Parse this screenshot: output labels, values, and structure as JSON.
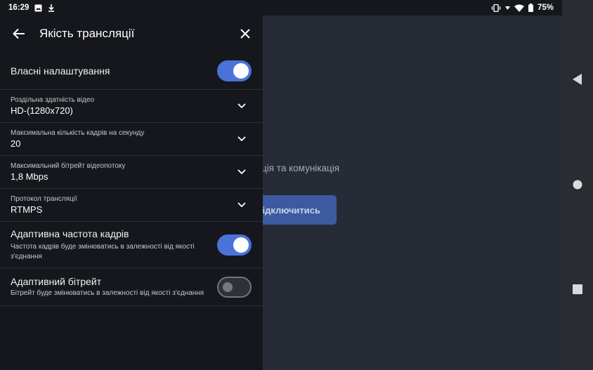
{
  "status_bar": {
    "time": "16:29",
    "battery": "75%",
    "icons": [
      "image-icon",
      "download-icon",
      "vibrate-icon",
      "signal-icon",
      "wifi-icon",
      "battery-icon"
    ]
  },
  "panel": {
    "title": "Якість трансляції",
    "own_settings": {
      "label": "Власні налаштування",
      "enabled": true
    },
    "resolution": {
      "label": "Роздільна здатність відео",
      "value": "HD-(1280x720)"
    },
    "fps": {
      "label": "Максимальна кількість кадрів на секунду",
      "value": "20"
    },
    "bitrate": {
      "label": "Максимальний бітрейт відеопотоку",
      "value": "1,8 Mbps"
    },
    "protocol": {
      "label": "Протокол трансляції",
      "value": "RTMPS"
    },
    "adaptive_fps": {
      "label": "Адаптивна частота кадрів",
      "description": "Частота кадрів буде змінюватись в залежності від якості з'єднання",
      "enabled": true
    },
    "adaptive_bitrate": {
      "label": "Адаптивний бітрейт",
      "description": "Бітрейт буде змінюватись в залежності від якості з'єднання",
      "enabled": false
    }
  },
  "background": {
    "text": "ція та комунікація",
    "button": "Підключитись"
  },
  "colors": {
    "accent": "#4a72d9",
    "panel_bg": "#15171c",
    "background_bg": "#262b36"
  }
}
